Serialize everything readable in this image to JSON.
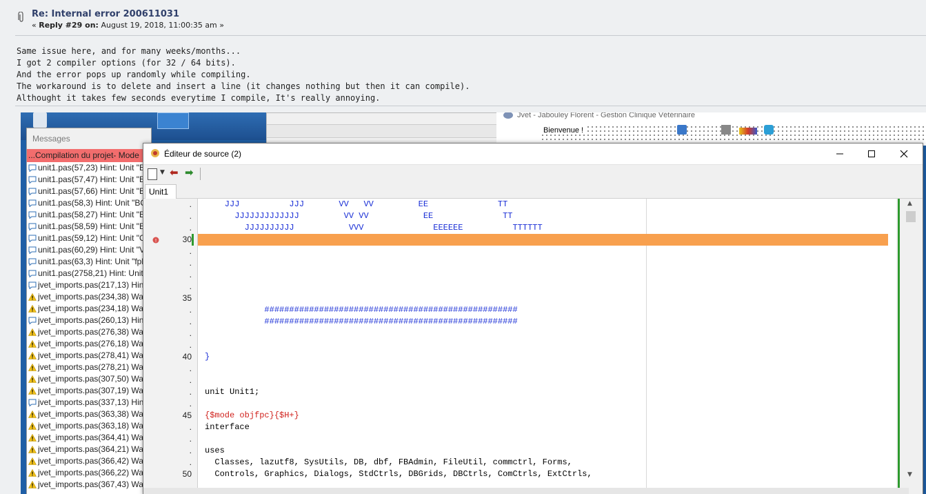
{
  "post": {
    "title": "Re: Internal error 200611031",
    "meta_prefix": "« ",
    "meta_reply": "Reply #29 on:",
    "meta_date": " August 19, 2018, 11:00:35 am »",
    "body_lines": [
      "Same issue here, and for many weeks/months...",
      "I got 2 compiler options (for 32 / 64 bits).",
      "And the error pops up randomly while compiling.",
      "The workaround is to delete and insert a line (it changes nothing but then it can compile).",
      "Althought it takes few seconds everytime I compile, It's really annoying."
    ]
  },
  "background_app": {
    "title": "Jvet - Jabouley Florent - Gestion Clinique Vétérinaire",
    "welcome": "Bienvenue !"
  },
  "messages": {
    "title": "Messages",
    "compile_line": "...Compilation du projet- Mode",
    "rows": [
      {
        "text": "unit1.pas(57,23) Hint: Unit \"B",
        "kind": "hint"
      },
      {
        "text": "unit1.pas(57,47) Hint: Unit \"B",
        "kind": "hint"
      },
      {
        "text": "unit1.pas(57,66) Hint: Unit \"B",
        "kind": "hint"
      },
      {
        "text": "unit1.pas(58,3) Hint: Unit \"BC",
        "kind": "hint"
      },
      {
        "text": "unit1.pas(58,27) Hint: Unit \"B",
        "kind": "hint"
      },
      {
        "text": "unit1.pas(58,59) Hint: Unit \"B",
        "kind": "hint"
      },
      {
        "text": "unit1.pas(59,12) Hint: Unit \"C",
        "kind": "hint"
      },
      {
        "text": "unit1.pas(60,29) Hint: Unit \"V",
        "kind": "hint"
      },
      {
        "text": "unit1.pas(63,3) Hint: Unit \"fpl",
        "kind": "hint"
      },
      {
        "text": "unit1.pas(2758,21) Hint: Unit",
        "kind": "hint"
      },
      {
        "text": "jvet_imports.pas(217,13) Hint",
        "kind": "hint"
      },
      {
        "text": "jvet_imports.pas(234,38) War",
        "kind": "warn"
      },
      {
        "text": "jvet_imports.pas(234,18) War",
        "kind": "warn"
      },
      {
        "text": "jvet_imports.pas(260,13) Hint",
        "kind": "hint"
      },
      {
        "text": "jvet_imports.pas(276,38) War",
        "kind": "warn"
      },
      {
        "text": "jvet_imports.pas(276,18) War",
        "kind": "warn"
      },
      {
        "text": "jvet_imports.pas(278,41) War",
        "kind": "warn"
      },
      {
        "text": "jvet_imports.pas(278,21) War",
        "kind": "warn"
      },
      {
        "text": "jvet_imports.pas(307,50) War",
        "kind": "warn"
      },
      {
        "text": "jvet_imports.pas(307,19) War",
        "kind": "warn"
      },
      {
        "text": "jvet_imports.pas(337,13) Hint",
        "kind": "hint"
      },
      {
        "text": "jvet_imports.pas(363,38) War",
        "kind": "warn"
      },
      {
        "text": "jvet_imports.pas(363,18) War",
        "kind": "warn"
      },
      {
        "text": "jvet_imports.pas(364,41) War",
        "kind": "warn"
      },
      {
        "text": "jvet_imports.pas(364,21) War",
        "kind": "warn"
      },
      {
        "text": "jvet_imports.pas(366,42) War",
        "kind": "warn"
      },
      {
        "text": "jvet_imports.pas(366,22) War",
        "kind": "warn"
      },
      {
        "text": "jvet_imports.pas(367,43) War",
        "kind": "warn"
      }
    ]
  },
  "editor": {
    "title": "Éditeur de source (2)",
    "tab": "Unit1",
    "gutter": [
      ".",
      ".",
      ".",
      "30",
      ".",
      ".",
      ".",
      ".",
      "35",
      ".",
      ".",
      ".",
      ".",
      "40",
      ".",
      ".",
      ".",
      ".",
      "45",
      ".",
      ".",
      ".",
      ".",
      "50"
    ],
    "code_lines": [
      {
        "text": "    JJJ          JJJ       VV   VV         EE              TT",
        "cls": "blue"
      },
      {
        "text": "      JJJJJJJJJJJJJ         VV VV           EE              TT",
        "cls": "blue"
      },
      {
        "text": "        JJJJJJJJJJ           VVV              EEEEEE          TTTTTT",
        "cls": "blue"
      },
      {
        "text": "",
        "cls": ""
      },
      {
        "text": "",
        "cls": ""
      },
      {
        "text": "",
        "cls": ""
      },
      {
        "text": "",
        "cls": ""
      },
      {
        "text": "",
        "cls": ""
      },
      {
        "text": "",
        "cls": ""
      },
      {
        "text": "            ###################################################",
        "cls": "blue"
      },
      {
        "text": "            ###################################################",
        "cls": "blue"
      },
      {
        "text": "",
        "cls": ""
      },
      {
        "text": "",
        "cls": ""
      },
      {
        "text": "}",
        "cls": "blue"
      },
      {
        "text": "",
        "cls": ""
      },
      {
        "text": "",
        "cls": ""
      },
      {
        "text": "unit Unit1;",
        "cls": ""
      },
      {
        "text": "",
        "cls": ""
      },
      {
        "text": "{$mode objfpc}{$H+}",
        "cls": "red"
      },
      {
        "text": "interface",
        "cls": ""
      },
      {
        "text": "",
        "cls": ""
      },
      {
        "text": "uses",
        "cls": ""
      },
      {
        "text": "  Classes, lazutf8, SysUtils, DB, dbf, FBAdmin, FileUtil, commctrl, Forms,",
        "cls": ""
      },
      {
        "text": "  Controls, Graphics, Dialogs, StdCtrls, DBGrids, DBCtrls, ComCtrls, ExtCtrls,",
        "cls": ""
      }
    ],
    "highlighted_line": 30,
    "colors": {
      "highlight": "#f8a04e",
      "keyword_blue": "#1a2fd6",
      "directive_red": "#d0211c"
    }
  }
}
